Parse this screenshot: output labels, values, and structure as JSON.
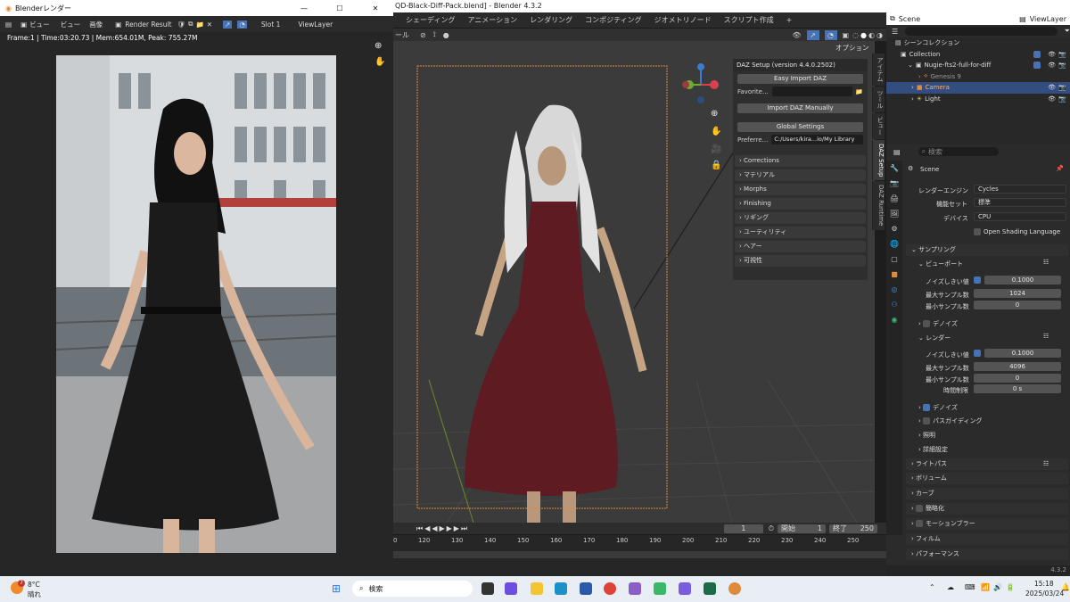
{
  "main_window": {
    "title": "QD-Black-Diff-Pack.blend] - Blender 4.3.2",
    "menu": [
      "シェーディング",
      "アニメーション",
      "レンダリング",
      "コンポジティング",
      "ジオメトリノード",
      "スクリプト作成"
    ],
    "add_tab": "+",
    "vp_menu_partial": "ール",
    "options_label": "オプション"
  },
  "daz_panel": {
    "header": "DAZ Setup (version 4.4.0.2502)",
    "easy_import": "Easy Import DAZ",
    "favorite_label": "Favorite...",
    "import_manually": "Import DAZ Manually",
    "global_settings": "Global Settings",
    "preferences_label": "Preferre...",
    "preferences_path": "C:/Users/kira...io/My Library",
    "sections": [
      "Corrections",
      "マテリアル",
      "Morphs",
      "Finishing",
      "リギング",
      "ユーティリティ",
      "ヘアー",
      "可視性"
    ]
  },
  "sidebar_tabs": [
    "アイテム",
    "ツール",
    "ビュー",
    "DAZ Setup",
    "DAZ Runtime"
  ],
  "timeline": {
    "current_frame": "1",
    "start_label": "開始",
    "start_value": "1",
    "end_label": "終了",
    "end_value": "250",
    "ruler": [
      "120",
      "130",
      "140",
      "150",
      "160",
      "170",
      "180",
      "190",
      "200",
      "210",
      "220",
      "230",
      "240",
      "250"
    ],
    "left_mark": "0"
  },
  "outliner": {
    "scene": "Scene",
    "view_layer": "ViewLayer",
    "root": "シーンコレクション",
    "items": [
      {
        "label": "Collection",
        "depth": 1
      },
      {
        "label": "Nugie-fts2-full-for-diff",
        "depth": 2
      },
      {
        "label": "Genesis 9",
        "depth": 3
      },
      {
        "label": "Camera",
        "depth": 2
      },
      {
        "label": "Light",
        "depth": 2
      }
    ]
  },
  "properties": {
    "search_placeholder": "検索",
    "scene": "Scene",
    "engine_label": "レンダーエンジン",
    "engine_value": "Cycles",
    "feature_label": "機能セット",
    "feature_value": "標準",
    "device_label": "デバイス",
    "device_value": "CPU",
    "osl_label": "Open Shading Language",
    "sampling": "サンプリング",
    "viewport": "ビューポート",
    "noise_label": "ノイズしきい値",
    "vp_noise": "0.1000",
    "max_samples_label": "最大サンプル数",
    "vp_max": "1024",
    "min_samples_label": "最小サンプル数",
    "vp_min": "0",
    "denoise": "デノイズ",
    "render": "レンダー",
    "r_noise": "0.1000",
    "r_max": "4096",
    "r_min": "0",
    "time_limit_label": "時間制限",
    "r_time": "0 s",
    "path_guiding": "パスガイディング",
    "lights": "照明",
    "advanced": "詳細設定",
    "light_paths": "ライトパス",
    "volumes": "ボリューム",
    "curves": "カーブ",
    "simplify": "簡略化",
    "motion_blur": "モーションブラー",
    "film": "フィルム",
    "performance": "パフォーマンス",
    "version": "4.3.2"
  },
  "render_window": {
    "title": "Blenderレンダー",
    "view": "ビュー",
    "view2": "ビュー",
    "image": "画像",
    "render_result": "Render Result",
    "slot": "Slot 1",
    "view_layer": "ViewLayer",
    "stats": "Frame:1 | Time:03:20.73 | Mem:654.01M, Peak: 755.27M"
  },
  "taskbar": {
    "temp": "8°C",
    "weather": "晴れ",
    "badge": "7",
    "search": "検索",
    "time": "15:18",
    "date": "2025/03/24"
  },
  "colors": {
    "accent": "#4772b3",
    "camera_frame": "#e08a3c",
    "dress": "#5e1b22"
  }
}
